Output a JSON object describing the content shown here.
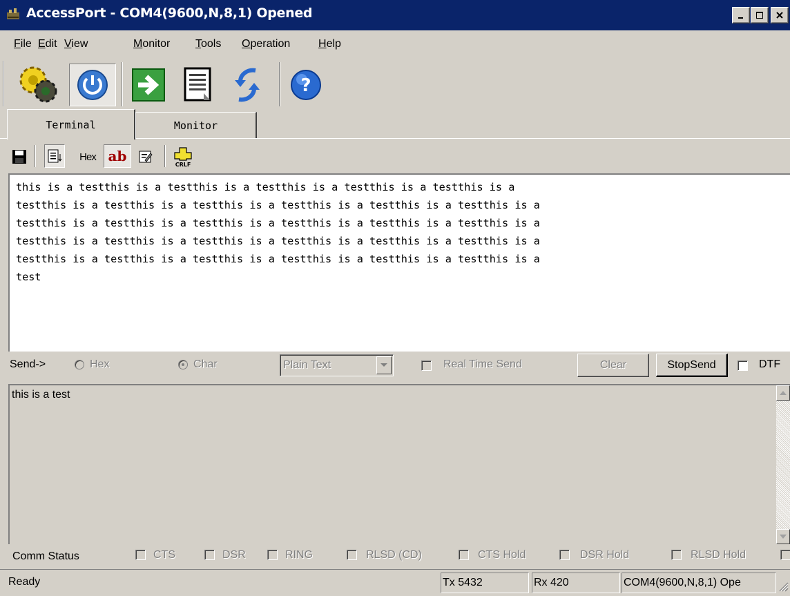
{
  "window": {
    "title": "AccessPort - COM4(9600,N,8,1) Opened"
  },
  "menu": [
    "File",
    "Edit",
    "View",
    "Monitor",
    "Tools",
    "Operation",
    "Help"
  ],
  "toolbar_icons": [
    "settings-gears-icon",
    "power-icon",
    "go-arrow-icon",
    "document-icon",
    "refresh-arrows-icon",
    "help-icon"
  ],
  "tabs": [
    "Terminal",
    "Monitor"
  ],
  "terminal_toolbar": {
    "hex_label": "Hex",
    "ab_label": "ab",
    "crlf_label": "CRLF"
  },
  "terminal_lines": [
    "this is a testthis is a testthis is a testthis is a testthis is a testthis is a",
    "testthis is a testthis is a testthis is a testthis is a testthis is a testthis is a",
    "testthis is a testthis is a testthis is a testthis is a testthis is a testthis is a",
    "testthis is a testthis is a testthis is a testthis is a testthis is a testthis is a",
    "testthis is a testthis is a testthis is a testthis is a testthis is a testthis is a",
    "test"
  ],
  "send_row": {
    "label": "Send->",
    "hex_option": "Hex",
    "char_option": "Char",
    "format_value": "Plain Text",
    "realtime_label": "Real Time Send",
    "clear_label": "Clear",
    "stopsend_label": "StopSend",
    "dtr_label": "DTF"
  },
  "send_text": "this is a test",
  "comm_status": {
    "label": "Comm Status",
    "items": [
      "CTS",
      "DSR",
      "RING",
      "RLSD (CD)",
      "CTS Hold",
      "DSR Hold",
      "RLSD Hold"
    ]
  },
  "statusbar": {
    "ready": "Ready",
    "tx": "Tx 5432",
    "rx": "Rx 420",
    "port": "COM4(9600,N,8,1) Ope"
  }
}
